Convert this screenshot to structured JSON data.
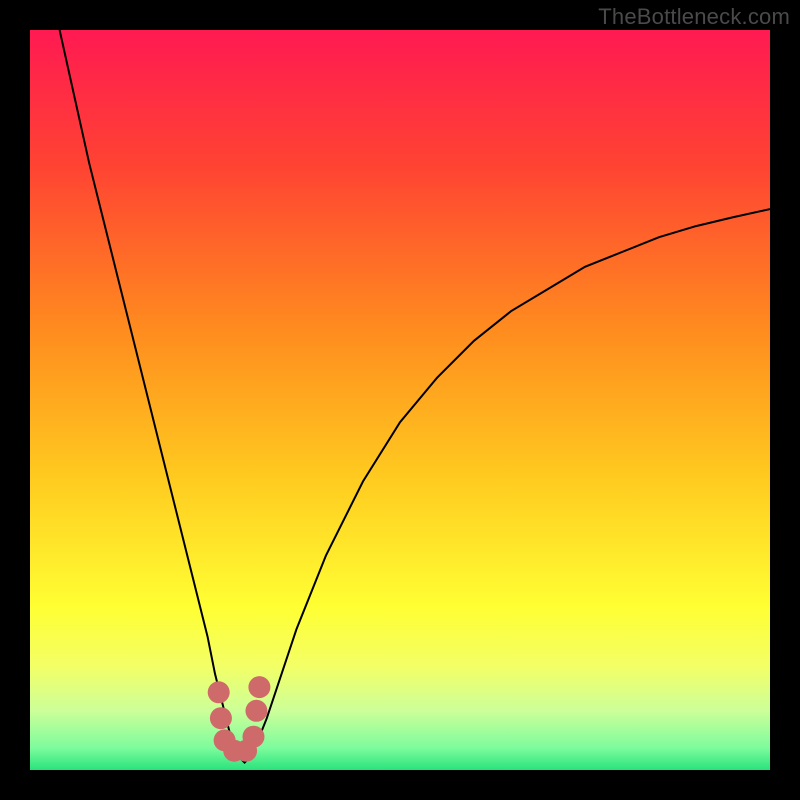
{
  "watermark": "TheBottleneck.com",
  "chart_data": {
    "type": "line",
    "title": "",
    "xlabel": "",
    "ylabel": "",
    "xlim": [
      0,
      100
    ],
    "ylim": [
      0,
      100
    ],
    "grid": false,
    "legend": false,
    "background_gradient_stops": [
      {
        "offset": 0.0,
        "color": "#ff1a52"
      },
      {
        "offset": 0.18,
        "color": "#ff4233"
      },
      {
        "offset": 0.4,
        "color": "#ff8a1f"
      },
      {
        "offset": 0.6,
        "color": "#ffc91f"
      },
      {
        "offset": 0.78,
        "color": "#ffff33"
      },
      {
        "offset": 0.86,
        "color": "#f3ff66"
      },
      {
        "offset": 0.92,
        "color": "#ccff99"
      },
      {
        "offset": 0.97,
        "color": "#7dfc9d"
      },
      {
        "offset": 1.0,
        "color": "#29e37d"
      }
    ],
    "series": [
      {
        "name": "bottleneck-curve",
        "color": "#000000",
        "stroke_width": 2,
        "x": [
          4,
          6,
          8,
          10,
          12,
          14,
          16,
          18,
          20,
          22,
          24,
          25,
          26,
          27,
          28,
          29,
          30,
          32,
          34,
          36,
          40,
          45,
          50,
          55,
          60,
          65,
          70,
          75,
          80,
          85,
          90,
          95,
          100
        ],
        "y": [
          100,
          91,
          82,
          74,
          66,
          58,
          50,
          42,
          34,
          26,
          18,
          13,
          9,
          5,
          2,
          1,
          2,
          7,
          13,
          19,
          29,
          39,
          47,
          53,
          58,
          62,
          65,
          68,
          70,
          72,
          73.5,
          74.7,
          75.8
        ]
      }
    ],
    "markers": {
      "name": "highlight-dots",
      "color": "#cf6a6a",
      "radius": 11,
      "points": [
        {
          "x": 25.5,
          "y": 10.5
        },
        {
          "x": 25.8,
          "y": 7.0
        },
        {
          "x": 26.3,
          "y": 4.0
        },
        {
          "x": 27.6,
          "y": 2.6
        },
        {
          "x": 29.2,
          "y": 2.6
        },
        {
          "x": 30.2,
          "y": 4.5
        },
        {
          "x": 30.6,
          "y": 8.0
        },
        {
          "x": 31.0,
          "y": 11.2
        }
      ]
    }
  }
}
